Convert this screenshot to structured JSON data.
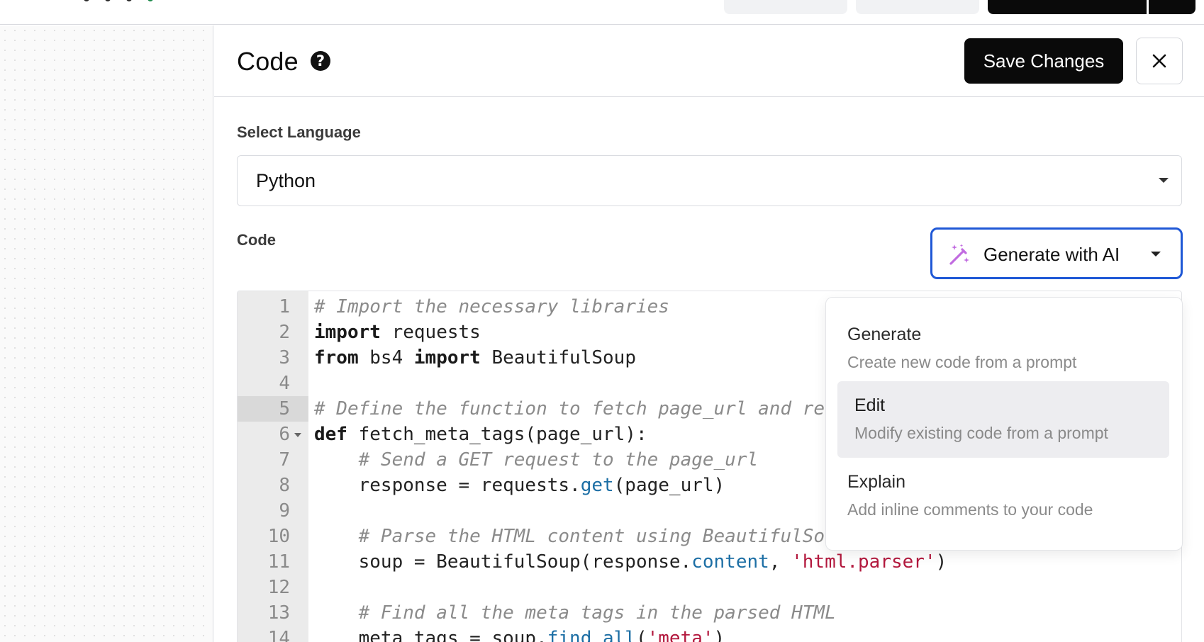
{
  "panel": {
    "title": "Code",
    "save_label": "Save Changes",
    "language_label": "Select Language",
    "language_value": "Python",
    "code_label": "Code",
    "ai_button_label": "Generate with AI"
  },
  "editor": {
    "lines": [
      {
        "n": "1",
        "html": "<span class=\"cm\"># Import the necessary libraries</span>"
      },
      {
        "n": "2",
        "html": "<span class=\"kw\">import</span> requests"
      },
      {
        "n": "3",
        "html": "<span class=\"kw\">from</span> bs4 <span class=\"kw\">import</span> BeautifulSoup"
      },
      {
        "n": "4",
        "html": ""
      },
      {
        "n": "5",
        "html": "<span class=\"cm\"># Define the function to fetch page_url and re</span>",
        "active": true
      },
      {
        "n": "6",
        "html": "<span class=\"kw\">def</span> fetch_meta_tags(page_url):",
        "fold": true
      },
      {
        "n": "7",
        "html": "    <span class=\"cm\"># Send a GET request to the page_url</span>"
      },
      {
        "n": "8",
        "html": "    response = requests.<span class=\"fn\">get</span>(page_url)"
      },
      {
        "n": "9",
        "html": ""
      },
      {
        "n": "10",
        "html": "    <span class=\"cm\"># Parse the HTML content using BeautifulSo</span>"
      },
      {
        "n": "11",
        "html": "    soup = BeautifulSoup(response.<span class=\"fn\">content</span>, <span class=\"str\">'html.parser'</span>)"
      },
      {
        "n": "12",
        "html": ""
      },
      {
        "n": "13",
        "html": "    <span class=\"cm\"># Find all the meta tags in the parsed HTML</span>"
      },
      {
        "n": "14",
        "html": "    meta_tags = soup.<span class=\"fn\">find_all</span>(<span class=\"str\">'meta'</span>)"
      }
    ]
  },
  "menu": {
    "items": [
      {
        "title": "Generate",
        "desc": "Create new code from a prompt"
      },
      {
        "title": "Edit",
        "desc": "Modify existing code from a prompt"
      },
      {
        "title": "Explain",
        "desc": "Add inline comments to your code"
      }
    ]
  },
  "colors": {
    "accent_border": "#1f58d6",
    "primary_button": "#0a0a0a",
    "wand_icon": "#c16be0"
  },
  "icons": {
    "help": "question-circle-icon",
    "close": "close-icon",
    "select_caret": "chevron-down-icon",
    "ai": "magic-wand-icon"
  }
}
